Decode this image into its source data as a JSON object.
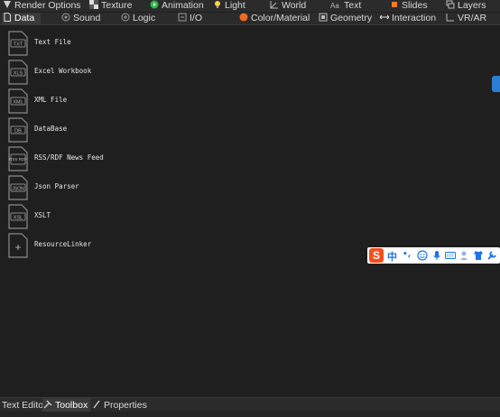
{
  "top_tabs": [
    {
      "label": "Render Options",
      "icon": "render-options-icon"
    },
    {
      "label": "Texture",
      "icon": "texture-icon"
    },
    {
      "label": "Animation",
      "icon": "animation-icon"
    },
    {
      "label": "Light",
      "icon": "light-icon"
    },
    {
      "label": "World",
      "icon": "world-icon"
    },
    {
      "label": "Text",
      "icon": "text-icon"
    },
    {
      "label": "Slides",
      "icon": "slides-icon"
    },
    {
      "label": "Layers",
      "icon": "layers-icon"
    }
  ],
  "second_tabs": [
    {
      "label": "Data",
      "icon": "data-icon",
      "active": true
    },
    {
      "label": "Sound",
      "icon": "sound-icon"
    },
    {
      "label": "Logic",
      "icon": "logic-icon"
    },
    {
      "label": "I/O",
      "icon": "io-icon"
    },
    {
      "label": "Color/Material",
      "icon": "color-material-icon"
    },
    {
      "label": "Geometry",
      "icon": "geometry-icon"
    },
    {
      "label": "Interaction",
      "icon": "interaction-icon"
    },
    {
      "label": "VR/AR",
      "icon": "vr-ar-icon"
    }
  ],
  "toolbox_items": [
    {
      "label": "Text File",
      "badge": "TXT",
      "icon": "text-file-icon"
    },
    {
      "label": "Excel Workbook",
      "badge": "XLS",
      "icon": "excel-workbook-icon"
    },
    {
      "label": "XML File",
      "badge": "XML",
      "icon": "xml-file-icon"
    },
    {
      "label": "DataBase",
      "badge": "DB",
      "icon": "database-icon"
    },
    {
      "label": "RSS/RDF News Feed",
      "badge": "RSS RDF",
      "icon": "rss-feed-icon"
    },
    {
      "label": "Json Parser",
      "badge": "JSON",
      "icon": "json-parser-icon"
    },
    {
      "label": "XSLT",
      "badge": "XSL",
      "icon": "xslt-icon"
    },
    {
      "label": "ResourceLinker",
      "badge": "+",
      "icon": "resource-linker-icon"
    }
  ],
  "ime_bar": {
    "logo": "S",
    "mode": "中",
    "punct": "•,"
  },
  "bottom_tabs": [
    {
      "label": "Text Editor"
    },
    {
      "label": "Toolbox",
      "active": true
    },
    {
      "label": "Properties"
    }
  ],
  "colors": {
    "background": "#1f1f1f",
    "tabbar": "#2b2b2b",
    "active_tab": "#3a3a3a",
    "ime_logo": "#f24f1c",
    "ime_accent": "#1a73e8",
    "side_tab": "#2a7fd4"
  }
}
